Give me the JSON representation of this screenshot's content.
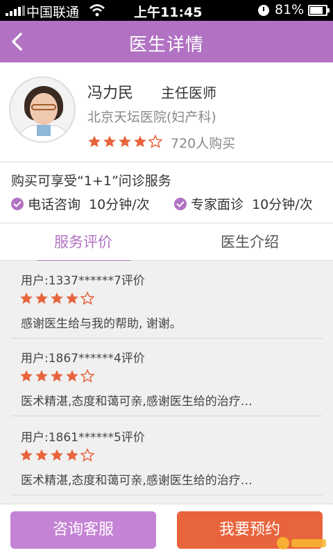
{
  "status_bar": {
    "carrier": "中国联通",
    "time": "上午11:45",
    "battery": "81%"
  },
  "nav": {
    "title": "医生详情"
  },
  "doctor": {
    "name": "冯力民",
    "title": "主任医师",
    "hospital": "北京天坛医院(妇产科)",
    "rating": 4,
    "max_rating": 5,
    "purchase_count": "720人购买"
  },
  "service": {
    "title": "购买可享受“1+1”问诊服务",
    "items": [
      {
        "label": "电话咨询  10分钟/次"
      },
      {
        "label": "专家面诊  10分钟/次"
      }
    ]
  },
  "tabs": [
    {
      "label": "服务评价",
      "active": true
    },
    {
      "label": "医生介绍",
      "active": false
    }
  ],
  "reviews": [
    {
      "user": "用户:1337******7评价",
      "rating": 4,
      "text": "感谢医生给与我的帮助, 谢谢。"
    },
    {
      "user": "用户:1867******4评价",
      "rating": 4,
      "text": "医术精湛,态度和蔼可亲,感谢医生给的治疗…"
    },
    {
      "user": "用户:1861******5评价",
      "rating": 4,
      "text": "医术精湛,态度和蔼可亲,感谢医生给的治疗…"
    }
  ],
  "actions": {
    "consult_label": "咨询客服",
    "book_label": "我要预约"
  },
  "colors": {
    "accent": "#b272c3",
    "star": "#e8643c",
    "book_button": "#e8643c",
    "consult_button": "#c583d5"
  },
  "icons": {
    "back": "chevron-left-icon",
    "check": "check-circle-icon",
    "star": "star-icon"
  }
}
